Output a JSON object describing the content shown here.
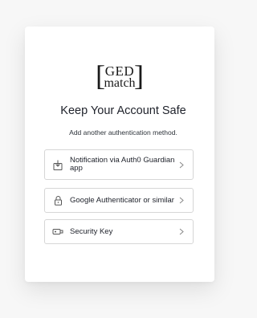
{
  "logo": {
    "top_text": "GED",
    "bottom_text": "match"
  },
  "title": "Keep Your Account Safe",
  "subtitle": "Add another authentication method.",
  "options": [
    {
      "label": "Notification via Auth0 Guardian app",
      "icon": "download-phone-icon"
    },
    {
      "label": "Google Authenticator or similar",
      "icon": "lock-icon"
    },
    {
      "label": "Security Key",
      "icon": "security-key-icon"
    }
  ]
}
